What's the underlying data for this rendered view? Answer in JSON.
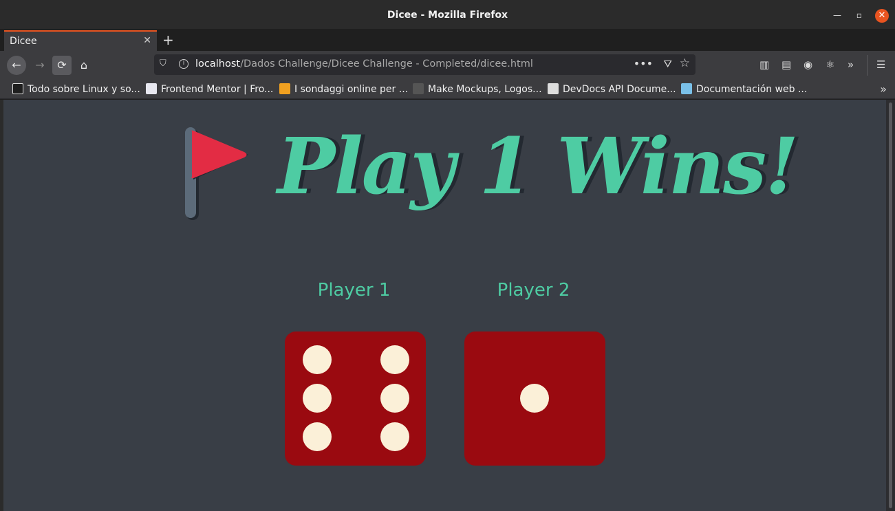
{
  "window": {
    "title": "Dicee - Mozilla Firefox"
  },
  "tabs": [
    {
      "label": "Dicee",
      "close": "✕"
    }
  ],
  "newtab": "+",
  "nav": {
    "back": "←",
    "forward": "→",
    "reload": "⟳",
    "home": "⌂",
    "url_host": "localhost",
    "url_path": "/Dados Challenge/Dicee Challenge - Completed/dicee.html",
    "more": "•••",
    "overflow": "»",
    "menu": "☰"
  },
  "bookmarks": [
    {
      "label": "Todo sobre Linux y so...",
      "color": "#ffffff"
    },
    {
      "label": "Frontend Mentor | Fro...",
      "color": "#e8e8f0"
    },
    {
      "label": "I sondaggi online per ...",
      "color": "#f0a020"
    },
    {
      "label": "Make Mockups, Logos...",
      "color": "#555555"
    },
    {
      "label": "DevDocs API Docume...",
      "color": "#dddddd"
    },
    {
      "label": "Documentación web ...",
      "color": "#7ac0e8"
    }
  ],
  "bookmarks_overflow": "»",
  "game": {
    "headline": "Play 1 Wins!",
    "players": [
      {
        "label": "Player 1",
        "value": 6
      },
      {
        "label": "Player 2",
        "value": 1
      }
    ]
  },
  "colors": {
    "background": "#393e46",
    "accent": "#4ecca3",
    "flag": "#e32c44",
    "pole": "#5c6b7a",
    "die": "#9a0a10",
    "pip": "#fbf0d8"
  }
}
